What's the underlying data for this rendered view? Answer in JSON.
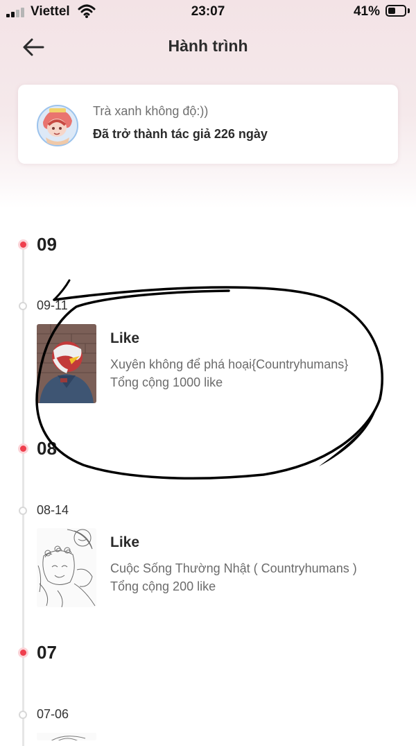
{
  "status_bar": {
    "carrier": "Viettel",
    "time": "23:07",
    "battery": "41%"
  },
  "header": {
    "title": "Hành trình",
    "back_icon": "arrow-left-icon"
  },
  "author": {
    "name": "Trà xanh không độ:))",
    "days_text": "Đã trở thành tác giả 226 ngày"
  },
  "timeline": {
    "months": [
      {
        "month": "09",
        "days": [
          {
            "date": "09-11",
            "entry": {
              "type": "Like",
              "title": "Xuyên không để phá hoại{Countryhumans}",
              "total": "Tổng cộng 1000 like"
            }
          }
        ]
      },
      {
        "month": "08",
        "days": [
          {
            "date": "08-14",
            "entry": {
              "type": "Like",
              "title": "Cuộc Sống Thường Nhật ( Countryhumans )",
              "total": "Tổng cộng 200 like"
            }
          }
        ]
      },
      {
        "month": "07",
        "days": [
          {
            "date": "07-06"
          }
        ]
      }
    ]
  },
  "colors": {
    "accent": "#ef3f4d",
    "header_tint": "#f3e3e6",
    "annotation_ink": "#000000"
  }
}
